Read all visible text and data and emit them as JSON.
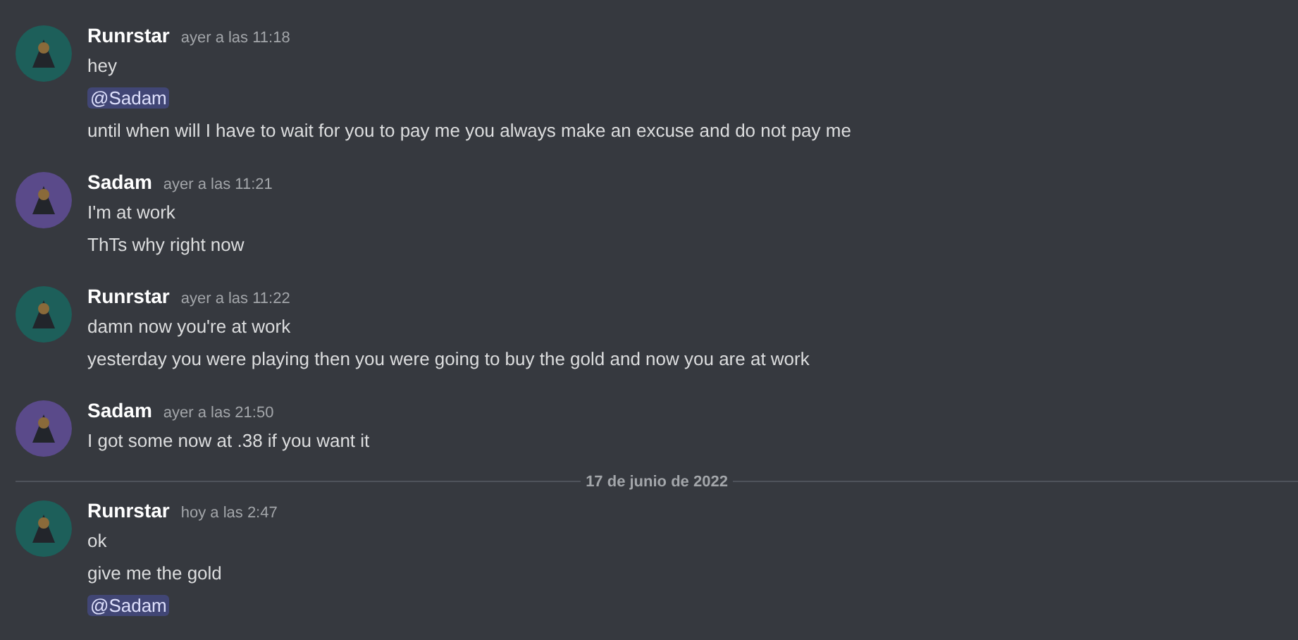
{
  "sections": [
    {
      "groups": [
        {
          "author": "Runrstar",
          "time": "ayer a las 11:18",
          "color": "#1d5f5a",
          "lines": [
            {
              "kind": "text",
              "text": "hey"
            },
            {
              "kind": "mention",
              "text": "@Sadam"
            },
            {
              "kind": "text",
              "text": "until when will I have to wait for you to pay me you always make an excuse and do not pay me"
            }
          ]
        },
        {
          "author": "Sadam",
          "time": "ayer a las 11:21",
          "color": "#5a4a8a",
          "lines": [
            {
              "kind": "text",
              "text": "I'm at work"
            },
            {
              "kind": "text",
              "text": "ThTs why right now"
            }
          ]
        },
        {
          "author": "Runrstar",
          "time": "ayer a las 11:22",
          "color": "#1d5f5a",
          "lines": [
            {
              "kind": "text",
              "text": "damn now you're at work"
            },
            {
              "kind": "text",
              "text": "yesterday you were playing then you were going to buy the gold and now you are at work"
            }
          ]
        },
        {
          "author": "Sadam",
          "time": "ayer a las 21:50",
          "color": "#5a4a8a",
          "lines": [
            {
              "kind": "text",
              "text": "I got some now at .38 if you want it"
            }
          ]
        }
      ]
    },
    {
      "date": "17 de junio de 2022",
      "groups": [
        {
          "author": "Runrstar",
          "time": "hoy a las 2:47",
          "color": "#1d5f5a",
          "lines": [
            {
              "kind": "text",
              "text": "ok"
            },
            {
              "kind": "text",
              "text": "give me the gold"
            },
            {
              "kind": "mention",
              "text": "@Sadam"
            }
          ]
        }
      ]
    }
  ]
}
